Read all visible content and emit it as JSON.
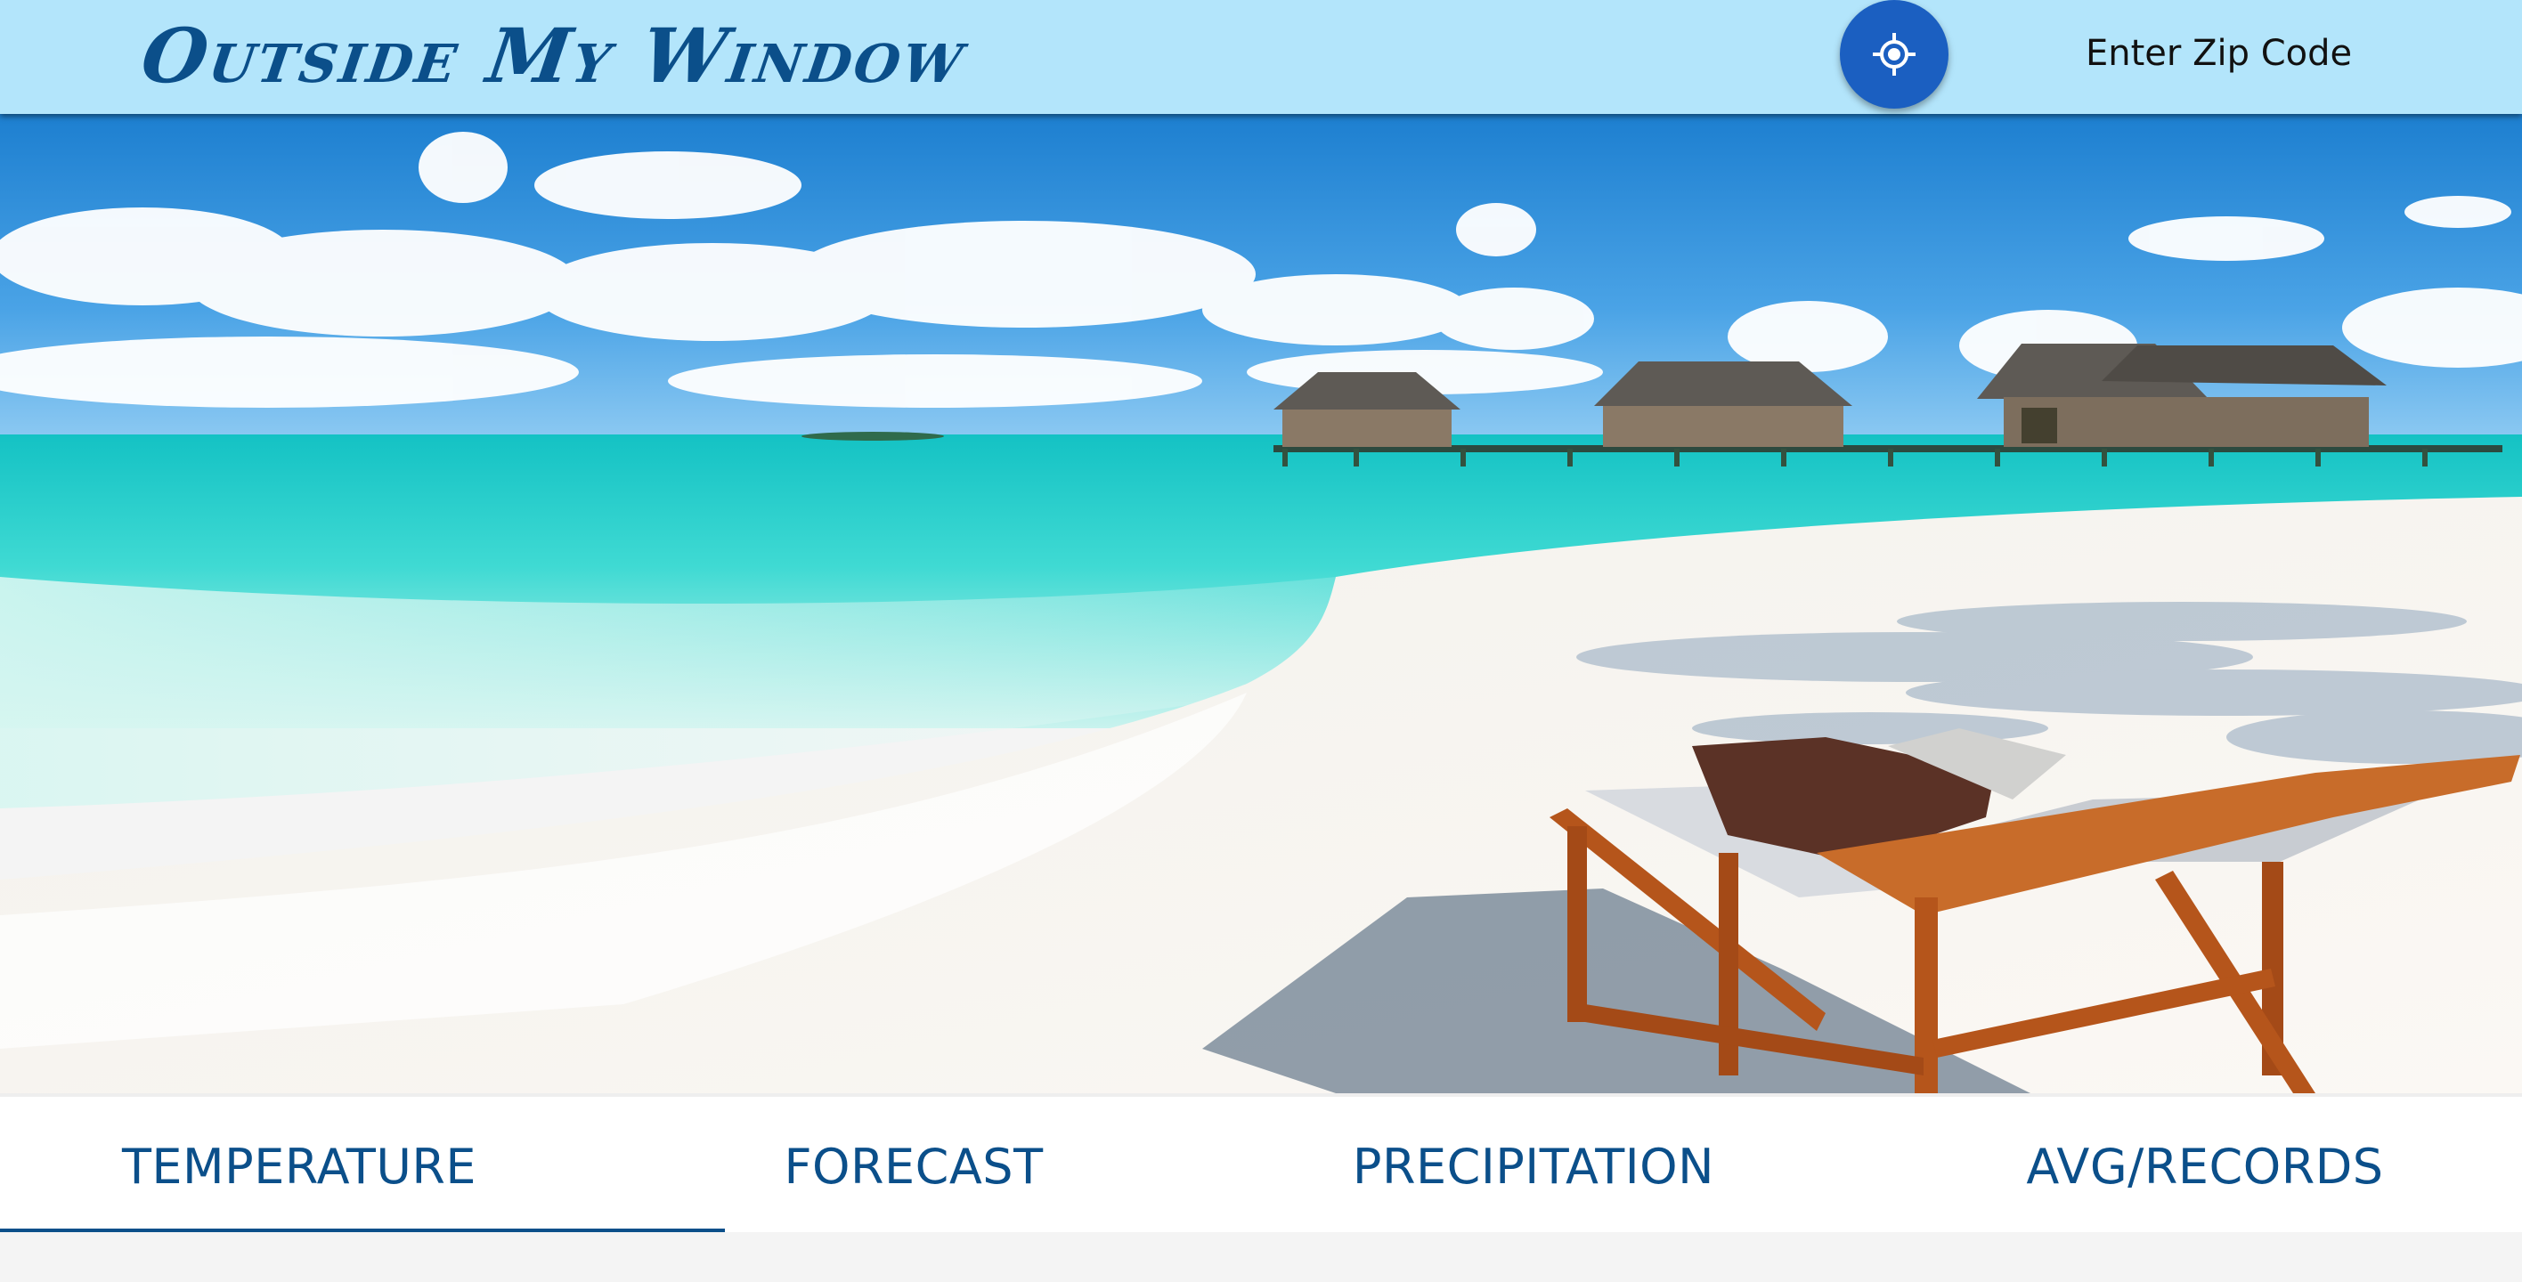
{
  "app": {
    "title": "Outside My Window"
  },
  "header": {
    "location_button_icon": "crosshair-location-icon",
    "zip_placeholder": "Enter Zip Code",
    "zip_value": ""
  },
  "hero": {
    "image_description_icon": "beach-scene-image"
  },
  "tabs": [
    {
      "label": "TEMPERATURE",
      "active": true
    },
    {
      "label": "FORECAST",
      "active": false
    },
    {
      "label": "PRECIPITATION",
      "active": false
    },
    {
      "label": "AVG/RECORDS",
      "active": false
    }
  ],
  "colors": {
    "app_bar": "#b3e5fb",
    "brand": "#0b4f8a",
    "location_button": "#1b5fc1"
  }
}
